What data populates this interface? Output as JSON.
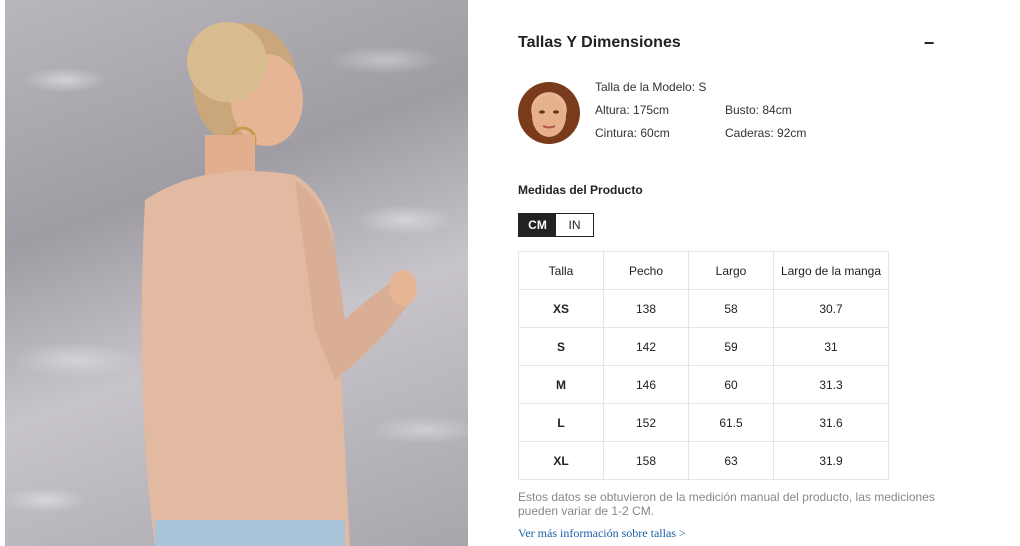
{
  "product_image": {
    "alt": "Modelo con blusa de punto color beige, vista de espalda"
  },
  "section": {
    "title": "Tallas Y Dimensiones",
    "collapse_symbol": "−"
  },
  "model": {
    "size": "Talla de la Modelo: S",
    "height": "Altura: 175cm",
    "bust": "Busto: 84cm",
    "waist": "Cintura: 60cm",
    "hips": "Caderas: 92cm"
  },
  "measurements": {
    "title": "Medidas del Producto",
    "units": {
      "active": "CM",
      "inactive": "IN"
    },
    "headers": [
      "Talla",
      "Pecho",
      "Largo",
      "Largo de la manga"
    ],
    "rows": [
      [
        "XS",
        "138",
        "58",
        "30.7"
      ],
      [
        "S",
        "142",
        "59",
        "31"
      ],
      [
        "M",
        "146",
        "60",
        "31.3"
      ],
      [
        "L",
        "152",
        "61.5",
        "31.6"
      ],
      [
        "XL",
        "158",
        "63",
        "31.9"
      ]
    ]
  },
  "note": "Estos datos se obtuvieron de la medición manual del producto, las mediciones pueden variar de 1-2 CM.",
  "more_link": "Ver más información sobre tallas >",
  "colors": {
    "shirt": "#e2b9a1",
    "skin": "#e6b595",
    "hair": "#c9a77b",
    "accent_dark": "#222222"
  }
}
